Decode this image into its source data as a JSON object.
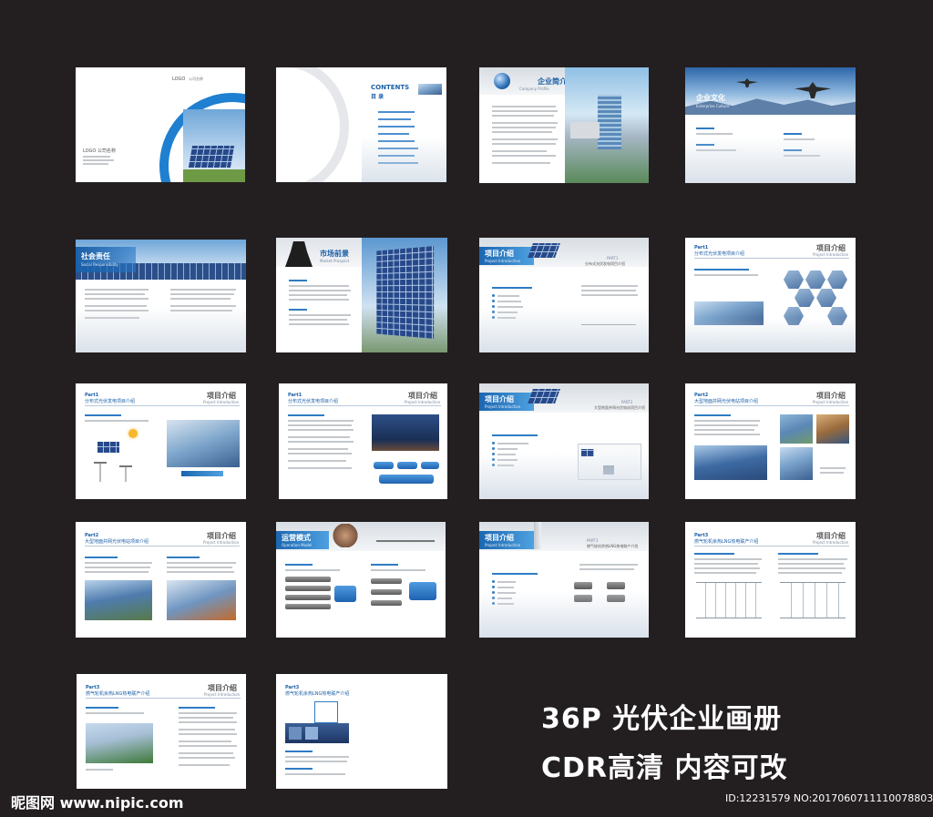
{
  "caption": {
    "line1": "36P 光伏企业画册",
    "line2": "CDR高清 内容可改"
  },
  "footer": {
    "logo": "昵图网 www.nipic.com",
    "id": "ID:12231579 NO:20170607111100788037"
  },
  "pages": {
    "cover": {
      "logo": "LOGO",
      "company": "公司名称",
      "logo_bottom": "LOGO 公司名称"
    },
    "contents": {
      "title": "CONTENTS",
      "subtitle": "目 录"
    },
    "company_profile": {
      "title": "企业简介",
      "sub": "Company Profile"
    },
    "enterprise_culture": {
      "title": "企业文化",
      "sub": "Enterprise Culture"
    },
    "social_responsibility": {
      "title": "社会责任",
      "sub": "Social Responsibility"
    },
    "market_prospect": {
      "title": "市场前景",
      "sub": "Market Prospect"
    },
    "project_intro": {
      "title": "项目介绍",
      "sub": "Project Introduction"
    },
    "operation_model": {
      "title": "运营模式",
      "sub": "Operation Model"
    },
    "part1": "Part1",
    "part2": "Part2",
    "part3": "Part3",
    "part1_heading": "分布式光伏发电项目介绍",
    "part2_heading": "大型地面并网光伏电站项目介绍",
    "part3_heading": "燃气轮机余热LNG热电联产介绍",
    "part2_label": "PART2"
  }
}
